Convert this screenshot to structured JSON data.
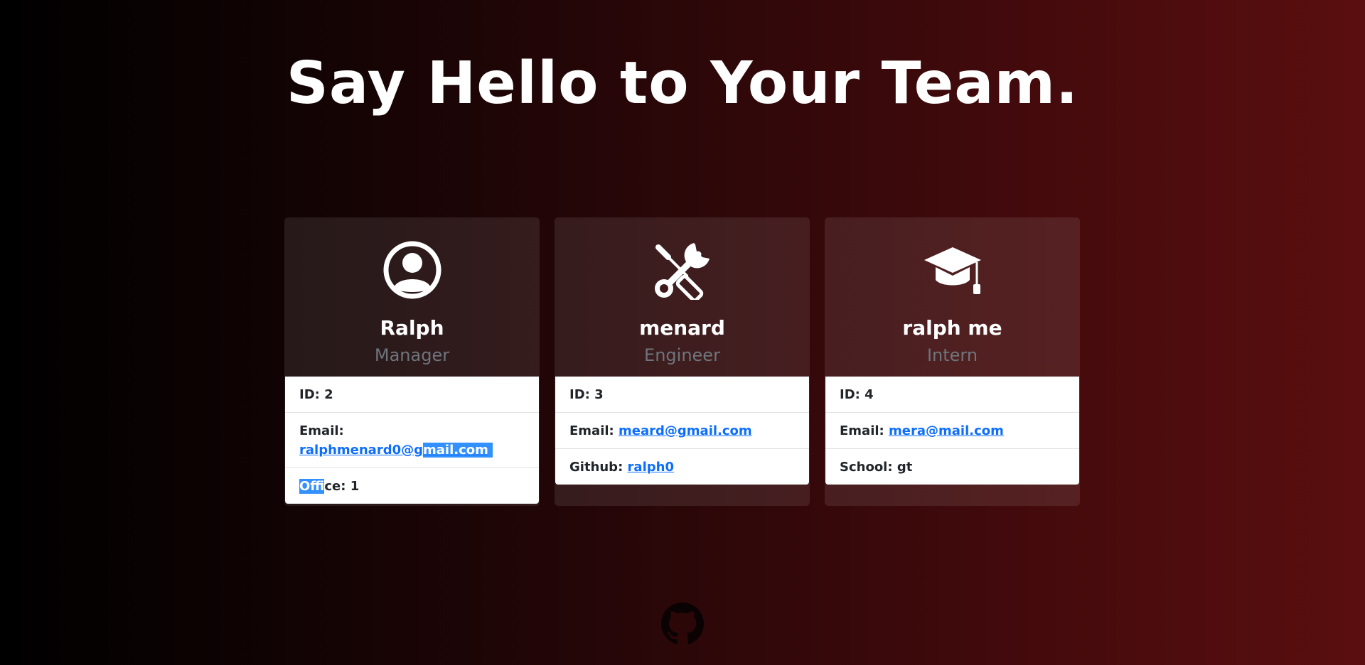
{
  "header": {
    "title": "Say Hello to Your Team."
  },
  "team": [
    {
      "name": "Ralph",
      "role": "Manager",
      "icon": "user-circle-icon",
      "id_label": "ID: 2",
      "email_label": "Email:",
      "email_part1": "ralphmenard0@g",
      "email_part2": "mail.com",
      "extra_label_part1": "Offi",
      "extra_label_part2": "ce: 1"
    },
    {
      "name": "menard",
      "role": "Engineer",
      "icon": "tools-icon",
      "id_label": "ID: 3",
      "email_label": "Email:",
      "email": "meard@gmail.com",
      "extra_label": "Github:",
      "extra_value": "ralph0"
    },
    {
      "name": "ralph me",
      "role": "Intern",
      "icon": "graduation-cap-icon",
      "id_label": "ID: 4",
      "email_label": "Email:",
      "email": "mera@mail.com",
      "extra_label": "School: gt"
    }
  ],
  "footer": {
    "icon": "github-icon"
  },
  "colors": {
    "role_text": "#6e757c",
    "link": "#0d6efd",
    "selection": "#3390ff"
  }
}
